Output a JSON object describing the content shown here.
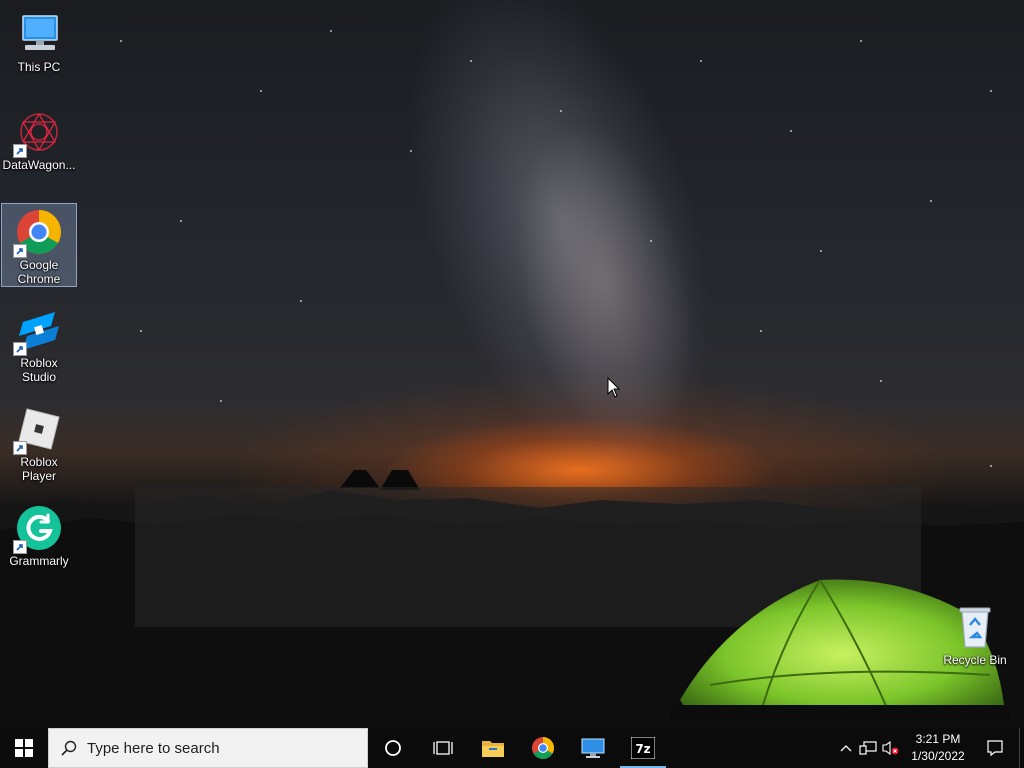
{
  "desktop": {
    "icons": [
      {
        "label": "This PC",
        "icon": "this-pc-icon"
      },
      {
        "label": "DataWagon...",
        "icon": "datawagon-icon"
      },
      {
        "label": "Google Chrome",
        "icon": "chrome-icon"
      },
      {
        "label": "Roblox Studio",
        "icon": "roblox-studio-icon"
      },
      {
        "label": "Roblox Player",
        "icon": "roblox-player-icon"
      },
      {
        "label": "Grammarly",
        "icon": "grammarly-icon"
      },
      {
        "label": "Recycle Bin",
        "icon": "recycle-bin-icon"
      }
    ]
  },
  "taskbar": {
    "search_placeholder": "Type here to search",
    "apps": [
      "cortana-icon",
      "task-view-icon",
      "file-explorer-icon",
      "chrome-icon",
      "remote-desktop-icon",
      "7zip-icon"
    ],
    "tray": {
      "time": "3:21 PM",
      "date": "1/30/2022"
    }
  },
  "colors": {
    "taskbar": "#0b0b0b",
    "accent": "#76b9ed",
    "tent": "#8fd13a"
  }
}
